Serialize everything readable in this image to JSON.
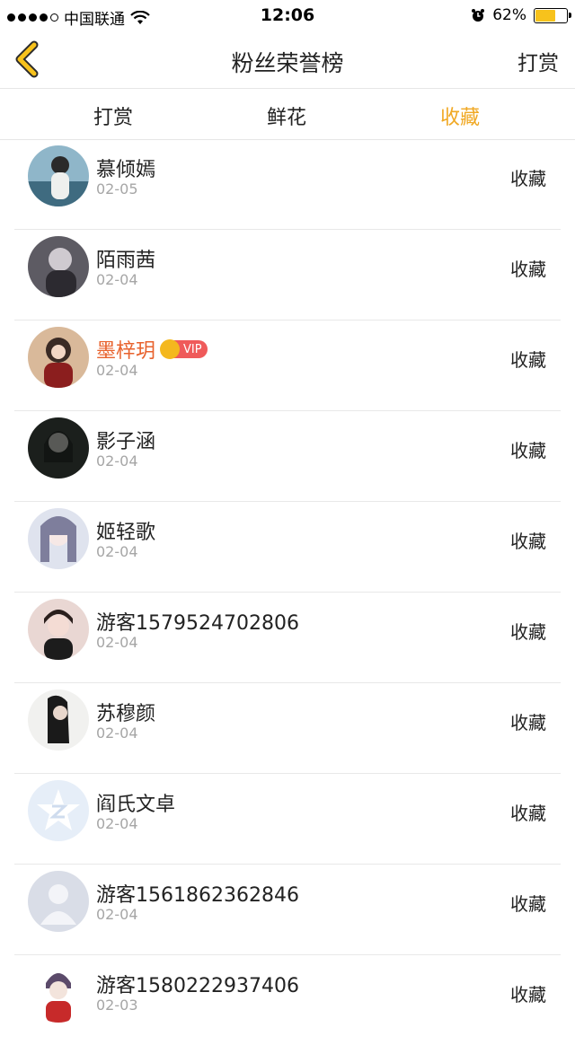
{
  "status_bar": {
    "carrier": "中国联通",
    "time": "12:06",
    "battery_percent": "62%",
    "battery_level": 0.62
  },
  "nav": {
    "title": "粉丝荣誉榜",
    "action_label": "打赏"
  },
  "tabs": [
    {
      "label": "打赏",
      "active": false
    },
    {
      "label": "鲜花",
      "active": false
    },
    {
      "label": "收藏",
      "active": true
    }
  ],
  "colors": {
    "accent": "#f0a823",
    "vip_name": "#e8622d",
    "vip_badge": "#ef5a5a"
  },
  "fans": [
    {
      "name": "慕倾嫣",
      "date": "02-05",
      "action": "收藏",
      "avatar_icon": "avatar-photo-icon",
      "vip": false
    },
    {
      "name": "陌雨茜",
      "date": "02-04",
      "action": "收藏",
      "avatar_icon": "avatar-photo-icon",
      "vip": false
    },
    {
      "name": "墨梓玥",
      "date": "02-04",
      "action": "收藏",
      "avatar_icon": "avatar-photo-icon",
      "vip": true,
      "badge": "VIP"
    },
    {
      "name": "影子涵",
      "date": "02-04",
      "action": "收藏",
      "avatar_icon": "avatar-photo-icon",
      "vip": false
    },
    {
      "name": "姬轻歌",
      "date": "02-04",
      "action": "收藏",
      "avatar_icon": "avatar-photo-icon",
      "vip": false
    },
    {
      "name": "游客1579524702806",
      "date": "02-04",
      "action": "收藏",
      "avatar_icon": "avatar-photo-icon",
      "vip": false
    },
    {
      "name": "苏穆颜",
      "date": "02-04",
      "action": "收藏",
      "avatar_icon": "avatar-photo-icon",
      "vip": false
    },
    {
      "name": "阎氏文卓",
      "date": "02-04",
      "action": "收藏",
      "avatar_icon": "default-star-avatar-icon",
      "vip": false
    },
    {
      "name": "游客1561862362846",
      "date": "02-04",
      "action": "收藏",
      "avatar_icon": "default-person-avatar-icon",
      "vip": false
    },
    {
      "name": "游客1580222937406",
      "date": "02-03",
      "action": "收藏",
      "avatar_icon": "avatar-photo-icon",
      "vip": false
    }
  ]
}
